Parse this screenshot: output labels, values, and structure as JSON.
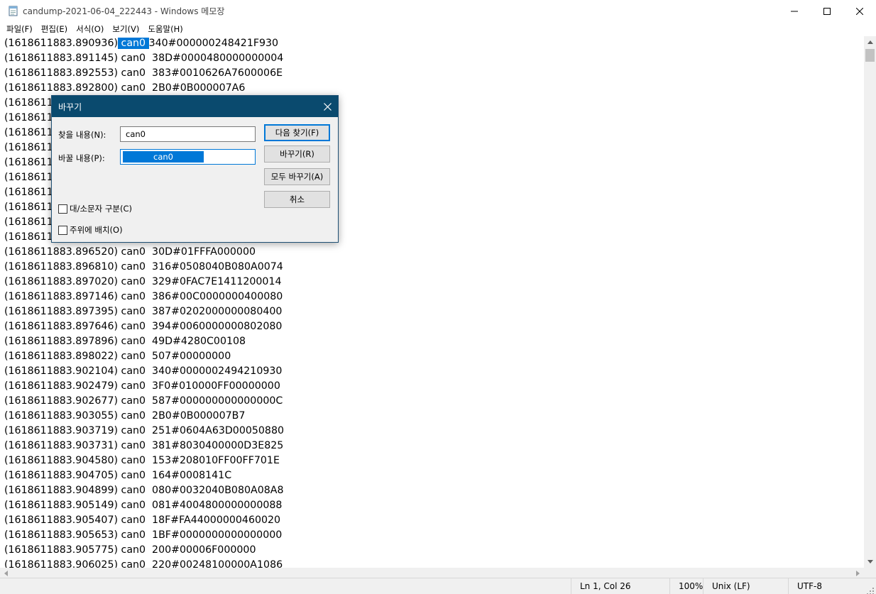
{
  "window": {
    "title": "candump-2021-06-04_222443 - Windows 메모장"
  },
  "menu": [
    {
      "label": "파일(F)"
    },
    {
      "label": "편집(E)"
    },
    {
      "label": "서식(O)"
    },
    {
      "label": "보기(V)"
    },
    {
      "label": "도움말(H)"
    }
  ],
  "editor": {
    "selected_text": "can0",
    "first_line": {
      "prefix": "(1618611883.890936)",
      "highlight": " can0 ",
      "suffix": "340#000000248421F930"
    },
    "lines": [
      "(1618611883.891145) can0  38D#0000480000000004",
      "(1618611883.892553) can0  383#0010626A7600006E",
      "(1618611883.892800) can0  2B0#0B000007A6",
      "(1618611",
      "(1618611",
      "(1618611",
      "(1618611",
      "(1618611",
      "(1618611",
      "(1618611",
      "(1618611",
      "(1618611",
      "(1618611",
      "(1618611883.896520) can0  30D#01FFFA000000",
      "(1618611883.896810) can0  316#0508040B080A0074",
      "(1618611883.897020) can0  329#0FAC7E1411200014",
      "(1618611883.897146) can0  386#00C0000000400080",
      "(1618611883.897395) can0  387#0202000000080400",
      "(1618611883.897646) can0  394#0060000000802080",
      "(1618611883.897896) can0  49D#4280C00108",
      "(1618611883.898022) can0  507#00000000",
      "(1618611883.902104) can0  340#0000002494210930",
      "(1618611883.902479) can0  3F0#010000FF00000000",
      "(1618611883.902677) can0  587#000000000000000C",
      "(1618611883.903055) can0  2B0#0B000007B7",
      "(1618611883.903719) can0  251#0604A63D00050880",
      "(1618611883.903731) can0  381#8030400000D3E825",
      "(1618611883.904580) can0  153#208010FF00FF701E",
      "(1618611883.904705) can0  164#0008141C",
      "(1618611883.904899) can0  080#0032040B080A08A8",
      "(1618611883.905149) can0  081#4004800000000088",
      "(1618611883.905407) can0  18F#FA44000000460020",
      "(1618611883.905653) can0  1BF#0000000000000000",
      "(1618611883.905775) can0  200#00006F000000",
      "(1618611883.906025) can0  220#00248100000A1086"
    ]
  },
  "status": {
    "position": "Ln 1, Col 26",
    "zoom": "100%",
    "line_ending": "Unix (LF)",
    "encoding": "UTF-8"
  },
  "dialog": {
    "title": "바꾸기",
    "find_label": "찾을 내용(N):",
    "find_value": "can0",
    "replace_label": "바꿀 내용(P):",
    "replace_value": "can0",
    "find_next_button": "다음 찾기(F)",
    "replace_button": "바꾸기(R)",
    "replace_all_button": "모두 바꾸기(A)",
    "cancel_button": "취소",
    "match_case_label": "대/소문자 구분(C)",
    "wrap_around_label": "주위에 배치(O)"
  },
  "colors": {
    "selection": "#0078d7",
    "dialog_titlebar": "#0a4a6e"
  }
}
